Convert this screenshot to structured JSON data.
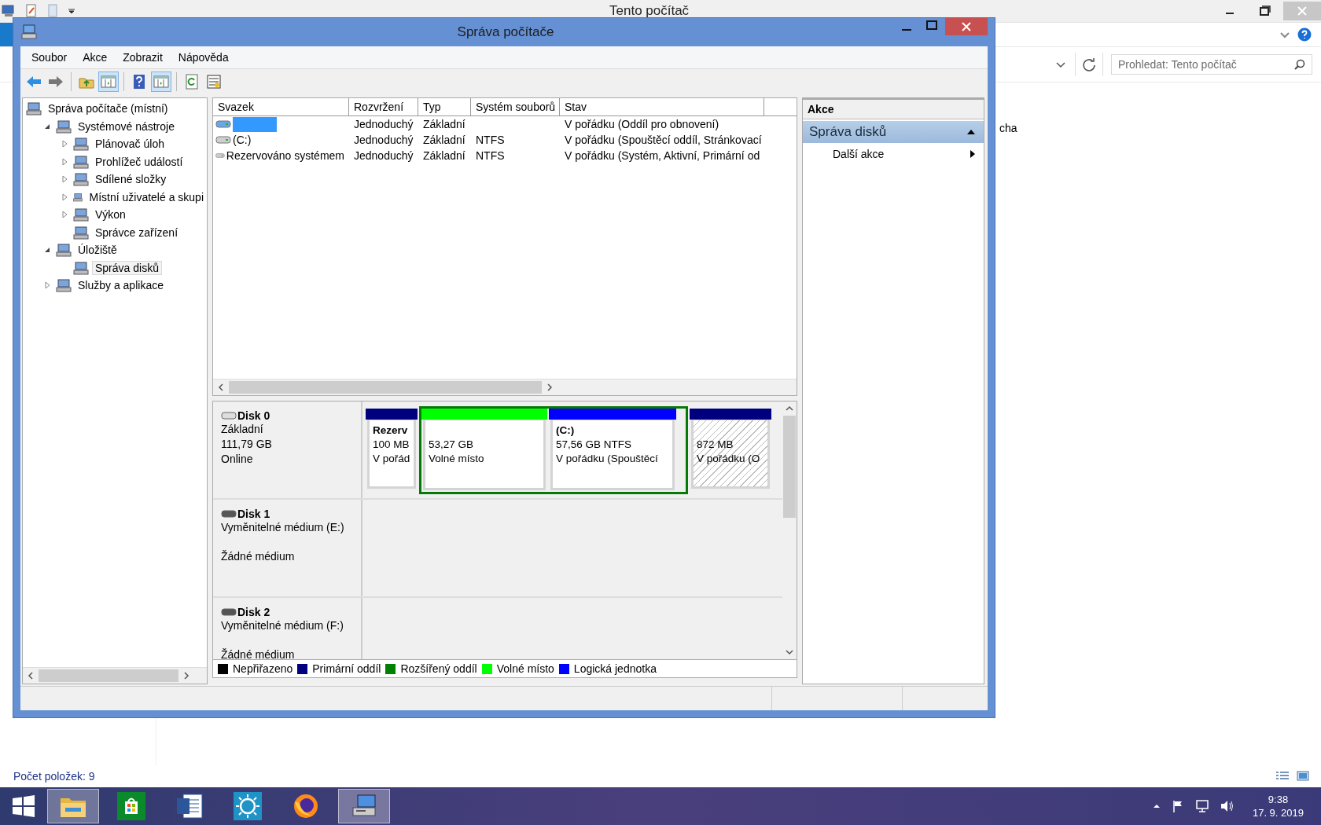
{
  "explorer": {
    "title": "Tento počítač",
    "search": {
      "placeholder": "Prohledat: Tento počítač"
    },
    "partial_item": "cha",
    "status": "Počet položek: 9"
  },
  "window": {
    "title": "Správa počítače"
  },
  "menu": [
    "Soubor",
    "Akce",
    "Zobrazit",
    "Nápověda"
  ],
  "toolbar": [
    {
      "kind": "back",
      "pressed": false
    },
    {
      "kind": "forward",
      "pressed": false
    },
    {
      "kind": "separator"
    },
    {
      "kind": "up",
      "pressed": false
    },
    {
      "kind": "tree-toggle",
      "pressed": true
    },
    {
      "kind": "separator"
    },
    {
      "kind": "help",
      "pressed": false
    },
    {
      "kind": "pane-toggle",
      "pressed": true
    },
    {
      "kind": "separator"
    },
    {
      "kind": "refresh",
      "pressed": false
    },
    {
      "kind": "properties",
      "pressed": false
    }
  ],
  "tree": [
    {
      "label": "Správa počítače (místní)",
      "selected": false,
      "children": [
        {
          "label": "Systémové nástroje",
          "selected": false,
          "expanded": true,
          "children": [
            {
              "label": "Plánovač úloh",
              "selected": false,
              "expanded": false
            },
            {
              "label": "Prohlížeč událostí",
              "selected": false,
              "expanded": false
            },
            {
              "label": "Sdílené složky",
              "selected": false,
              "expanded": false
            },
            {
              "label": "Místní uživatelé a skupi",
              "selected": false,
              "expanded": false
            },
            {
              "label": "Výkon",
              "selected": false,
              "expanded": false
            },
            {
              "label": "Správce zařízení",
              "selected": false
            }
          ]
        },
        {
          "label": "Úložiště",
          "selected": false,
          "expanded": true,
          "children": [
            {
              "label": "Správa disků",
              "selected": true
            }
          ]
        },
        {
          "label": "Služby a aplikace",
          "selected": false,
          "expanded": false
        }
      ]
    }
  ],
  "volumes": {
    "columns": [
      "Svazek",
      "Rozvržení",
      "Typ",
      "Systém souborů",
      "Stav"
    ],
    "rows": [
      {
        "selected": true,
        "layout": "Jednoduchý",
        "type": "Základní",
        "status": "V pořádku (Oddíl pro obnovení)"
      },
      {
        "selected": false,
        "volume": "(C:)",
        "layout": "Jednoduchý",
        "type": "Základní",
        "fs": "NTFS",
        "status": "V pořádku (Spouštěcí oddíl, Stránkovací"
      },
      {
        "selected": false,
        "volume": "Rezervováno systémem",
        "layout": "Jednoduchý",
        "type": "Základní",
        "fs": "NTFS",
        "status": "V pořádku (Systém, Aktivní, Primární od"
      }
    ]
  },
  "disks": [
    {
      "title": "Disk 0",
      "kind": "basic",
      "type": "Základní",
      "size": "111,79 GB",
      "status": "Online",
      "partitions": [
        {
          "kind": "primary",
          "name": "Rezerv",
          "size": "100 MB",
          "status": "V pořád",
          "selected": false
        },
        {
          "kind": "extended",
          "children": [
            {
              "kind": "free",
              "size": "53,27 GB",
              "status": "Volné místo",
              "selected": false
            },
            {
              "kind": "logical",
              "name": "(C:)",
              "size": "57,56 GB NTFS",
              "status": "V pořádku (Spouštěcí",
              "selected": false
            }
          ]
        },
        {
          "kind": "primary",
          "size": "872 MB",
          "status": "V pořádku (O",
          "selected": true
        }
      ]
    },
    {
      "title": "Disk 1",
      "kind": "removable",
      "type": "Vyměnitelné médium (E:)",
      "status": "Žádné médium"
    },
    {
      "title": "Disk 2",
      "kind": "removable",
      "type": "Vyměnitelné médium (F:)",
      "status": "Žádné médium"
    }
  ],
  "legend": [
    {
      "label": "Nepřiřazeno",
      "color": "#000000"
    },
    {
      "label": "Primární oddíl",
      "color": "#00007f"
    },
    {
      "label": "Rozšířený oddíl",
      "color": "#007f00"
    },
    {
      "label": "Volné místo",
      "color": "#00ff00"
    },
    {
      "label": "Logická jednotka",
      "color": "#0000ff"
    }
  ],
  "actions": {
    "title": "Akce",
    "sections": [
      {
        "label": "Správa disků",
        "expanded": true,
        "items": [
          "Další akce"
        ]
      }
    ]
  },
  "taskbar": {
    "apps": [
      {
        "kind": "folder",
        "active": true
      },
      {
        "kind": "store",
        "active": false
      },
      {
        "kind": "document",
        "active": false
      },
      {
        "kind": "sun",
        "active": false
      },
      {
        "kind": "browser",
        "active": false
      },
      {
        "kind": "computer",
        "active": true
      }
    ],
    "time": "9:38",
    "date": "17. 9. 2019"
  }
}
